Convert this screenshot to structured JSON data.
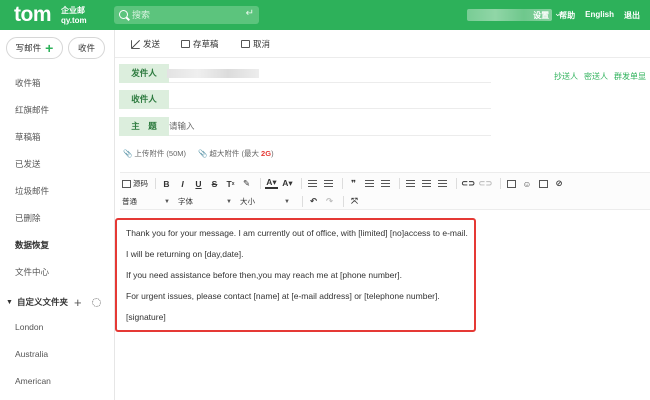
{
  "header": {
    "logo": "tom",
    "logo_line1": "企业邮",
    "logo_line2": "qy.tom",
    "search_placeholder": "搜索",
    "links": [
      "设置",
      "帮助",
      "English",
      "退出"
    ]
  },
  "sidebar": {
    "write_label": "写邮件",
    "receive_label": "收件",
    "items": [
      {
        "label": "收件箱"
      },
      {
        "label": "红旗邮件"
      },
      {
        "label": "草稿箱"
      },
      {
        "label": "已发送"
      },
      {
        "label": "垃圾邮件"
      },
      {
        "label": "已删除"
      },
      {
        "label": "数据恢复"
      },
      {
        "label": "文件中心"
      }
    ],
    "folders_label": "自定义文件夹",
    "folders": [
      "London",
      "Australia",
      "American"
    ]
  },
  "actions": {
    "send": "发送",
    "save_draft": "存草稿",
    "cancel": "取消"
  },
  "compose": {
    "from_label": "发件人",
    "to_label": "收件人",
    "subject_label": "主　题",
    "subject_placeholder": "请输入",
    "cc": "抄送人",
    "bcc": "密送人",
    "group_send": "群发单显",
    "upload_attachment": "上传附件 (50M)",
    "super_attachment": "超大附件 (最大",
    "super_attachment_size": "2G",
    "super_attachment_end": ")"
  },
  "editor": {
    "source_label": "源码",
    "paragraph_format": "普通",
    "font_family": "字体",
    "font_size": "大小"
  },
  "body_lines": [
    "Thank you for your message. I am currently out of office, with [limited] [no]access to e-mail.",
    "I will be returning on [day,date].",
    "If you need assistance before then,you may reach me at [phone number].",
    "For urgent issues, please contact [name] at [e-mail address] or [telephone number].",
    "[signature]"
  ],
  "colors": {
    "brand_green": "#2db15a",
    "highlight_red": "#e53935"
  }
}
